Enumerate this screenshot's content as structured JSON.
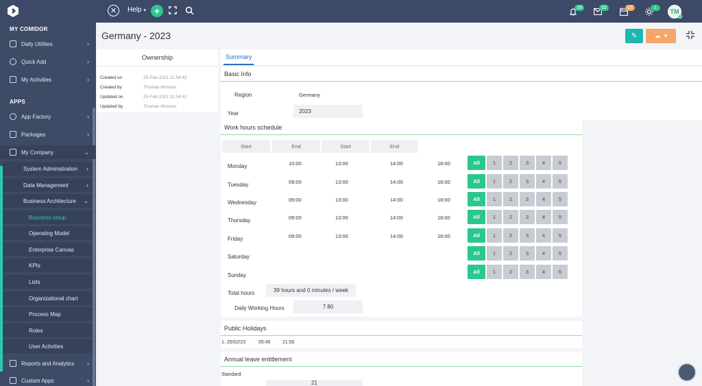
{
  "topbar": {
    "help_label": "Help",
    "badges": {
      "notifications": "18",
      "messages": "32",
      "calendar": "17",
      "activity": "1"
    },
    "avatar_initials": "TM",
    "icons": [
      "logo-icon",
      "close-circle-icon",
      "chevron-down-icon",
      "plus-icon",
      "fullscreen-icon",
      "search-icon",
      "bell-icon",
      "mail-icon",
      "calendar-icon",
      "sun-icon"
    ]
  },
  "sidebar": {
    "section_mycomidor": "MY COMIDOR",
    "section_apps": "APPS",
    "items": {
      "daily_utilities": "Daily Utilities",
      "quick_add": "Quick Add",
      "my_activities": "My Activities",
      "app_factory": "App Factory",
      "packages": "Packages",
      "my_company": "My Company",
      "system_administration": "System Administration",
      "data_management": "Data Management",
      "business_architecture": "Business Architecture",
      "business_setup": "Business setup",
      "operating_model": "Operating Model",
      "enterprise_canvas": "Enterprise Canvas",
      "kpis": "KPIs",
      "lists": "Lists",
      "organizational_chart": "Organizational chart",
      "process_map": "Process Map",
      "roles": "Roles",
      "user_activities": "User Activities",
      "reports_analytics": "Reports and Analytics",
      "custom_apps": "Custom Apps"
    }
  },
  "page": {
    "title": "Germany - 2023"
  },
  "ownership": {
    "title": "Ownership",
    "rows": [
      {
        "label": "Created on",
        "value": "25-Feb-2021 11:54:42"
      },
      {
        "label": "Created by",
        "value": "Thomas Monson"
      },
      {
        "label": "Updated on",
        "value": "25-Feb-2021 11:54:42"
      },
      {
        "label": "Updated by",
        "value": "Thomas Monson"
      }
    ]
  },
  "tabs": {
    "summary": "Summary"
  },
  "basic_info": {
    "header": "Basic Info",
    "region_label": "Region",
    "region_value": "Germany",
    "year_label": "Year",
    "year_value": "2023"
  },
  "work_hours": {
    "header": "Work hours schedule",
    "col_headers": [
      "Start",
      "End",
      "Start",
      "End"
    ],
    "days": [
      {
        "name": "Monday",
        "times": [
          "10:00",
          "13:00",
          "14:00",
          "18:00"
        ]
      },
      {
        "name": "Tuesday",
        "times": [
          "09:00",
          "13:00",
          "14:00",
          "18:00"
        ]
      },
      {
        "name": "Wednesday",
        "times": [
          "09:00",
          "13:00",
          "14:00",
          "18:00"
        ]
      },
      {
        "name": "Thursday",
        "times": [
          "09:00",
          "13:00",
          "14:00",
          "18:00"
        ]
      },
      {
        "name": "Friday",
        "times": [
          "09:00",
          "13:00",
          "14:00",
          "18:00"
        ]
      },
      {
        "name": "Saturday",
        "times": [
          "",
          "",
          "",
          ""
        ]
      },
      {
        "name": "Sunday",
        "times": [
          "",
          "",
          "",
          ""
        ]
      }
    ],
    "week_buttons": [
      "All",
      "1",
      "2",
      "3",
      "4",
      "5"
    ],
    "total_hours_label": "Total hours",
    "total_hours_value": "39 hours and 0 minutes / week",
    "daily_working_label": "Daily Working Hours",
    "daily_working_value": "7.80"
  },
  "public_holidays": {
    "header": "Public Holidays",
    "row": {
      "date": "1. 25/02/23",
      "start": "05:45",
      "end": "21:50"
    }
  },
  "annual_leave": {
    "header": "Annual leave entitlement",
    "standard_label": "Standard",
    "standard_value": "21"
  },
  "colors": {
    "sidebar": "#3e4b66",
    "topbar": "#3c4a67",
    "accent_green": "#2cc78e",
    "teal": "#1fb5b0",
    "orange": "#f5a56a"
  }
}
